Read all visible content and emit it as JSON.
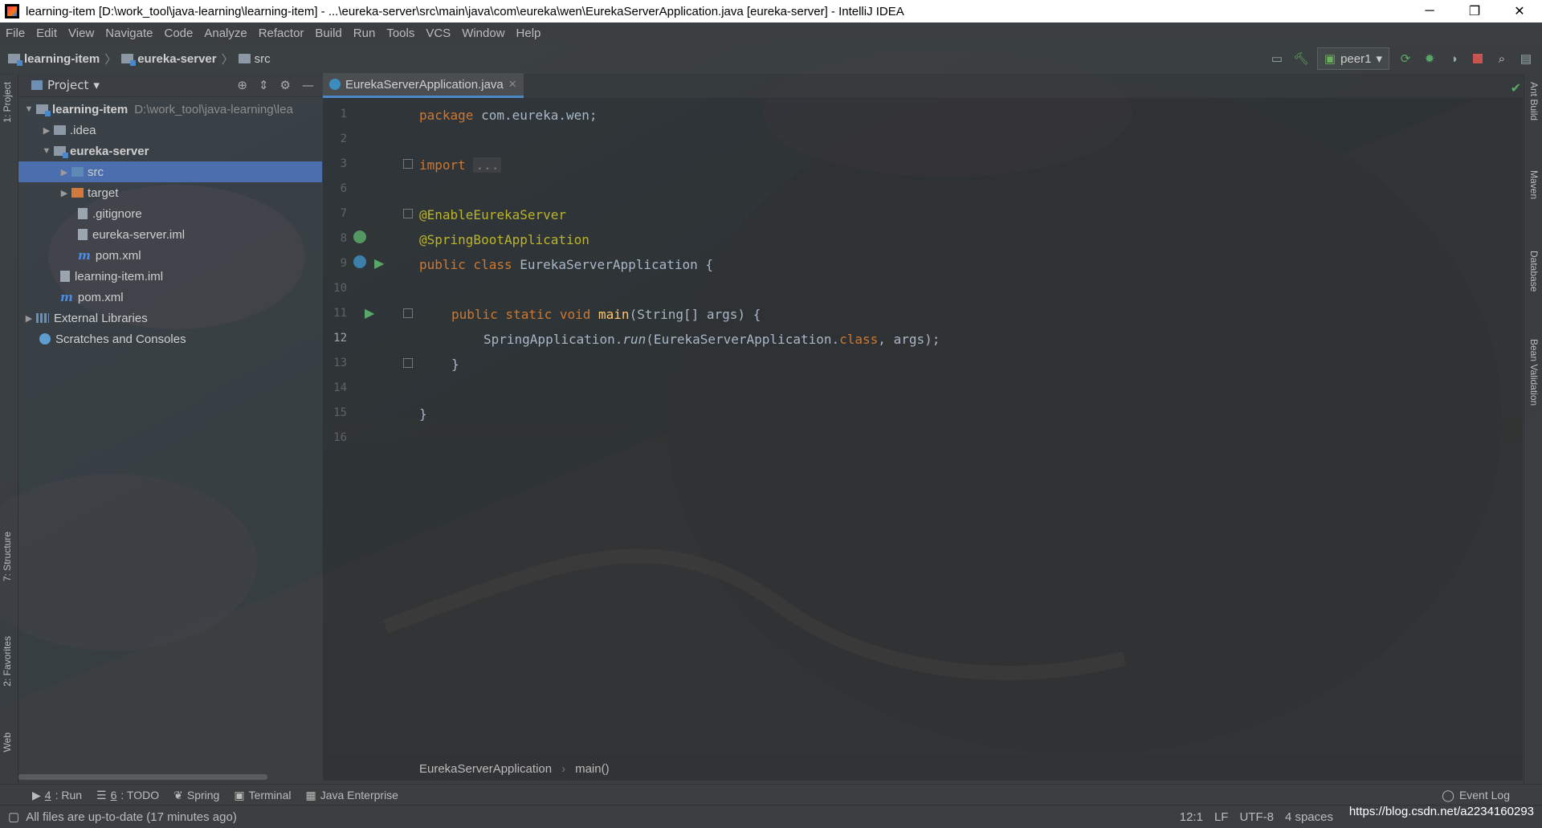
{
  "window": {
    "title": "learning-item [D:\\work_tool\\java-learning\\learning-item] - ...\\eureka-server\\src\\main\\java\\com\\eureka\\wen\\EurekaServerApplication.java [eureka-server] - IntelliJ IDEA",
    "controls": [
      "─",
      "❐",
      "✕"
    ]
  },
  "menu": [
    "File",
    "Edit",
    "View",
    "Navigate",
    "Code",
    "Analyze",
    "Refactor",
    "Build",
    "Run",
    "Tools",
    "VCS",
    "Window",
    "Help"
  ],
  "breadcrumb": [
    "learning-item",
    "eureka-server",
    "src"
  ],
  "toolbar": {
    "run_config": "peer1"
  },
  "left_strip": {
    "project": "1: Project",
    "structure": "7: Structure",
    "favorites": "2: Favorites",
    "web": "Web"
  },
  "right_strip": {
    "ant": "Ant Build",
    "maven": "Maven",
    "database": "Database",
    "bean": "Bean Validation"
  },
  "project_panel": {
    "title": "Project",
    "tree": [
      {
        "label": "learning-item",
        "path": "D:\\work_tool\\java-learning\\lea"
      },
      {
        "label": ".idea"
      },
      {
        "label": "eureka-server"
      },
      {
        "label": "src"
      },
      {
        "label": "target"
      },
      {
        "label": ".gitignore"
      },
      {
        "label": "eureka-server.iml"
      },
      {
        "label": "pom.xml"
      },
      {
        "label": "learning-item.iml"
      },
      {
        "label": "pom.xml"
      },
      {
        "label": "External Libraries"
      },
      {
        "label": "Scratches and Consoles"
      }
    ]
  },
  "editor": {
    "tab": "EurekaServerApplication.java",
    "line_numbers": [
      "1",
      "2",
      "3",
      "6",
      "7",
      "8",
      "9",
      "10",
      "11",
      "12",
      "13",
      "14",
      "15",
      "16"
    ],
    "code": {
      "l1_kw": "package",
      "l1_rest": " com.eureka.wen;",
      "l3_kw": "import",
      "l3_fold": "...",
      "l7": "@EnableEurekaServer",
      "l8": "@SpringBootApplication",
      "l9_kw": "public class",
      "l9_rest": " EurekaServerApplication {",
      "l11_kw": "public static void",
      "l11_fn": "main",
      "l11_rest": "(String[] args) {",
      "l12_a": "SpringApplication.",
      "l12_run": "run",
      "l12_b": "(EurekaServerApplication.",
      "l12_cls": "class",
      "l12_c": ", args);",
      "l13": "}",
      "l15": "}"
    },
    "crumbs": [
      "EurekaServerApplication",
      "main()"
    ]
  },
  "bottom_tools": [
    {
      "num": "4",
      "label": ": Run"
    },
    {
      "num": "6",
      "label": ": TODO"
    },
    {
      "label": "Spring"
    },
    {
      "label": "Terminal"
    },
    {
      "label": "Java Enterprise"
    }
  ],
  "event_log": "Event Log",
  "status": {
    "message": "All files are up-to-date (17 minutes ago)",
    "position": "12:1",
    "line_sep": "LF",
    "encoding": "UTF-8",
    "indent": "4 spaces"
  },
  "watermark": "https://blog.csdn.net/a2234160293",
  "colors": {
    "selection": "#4b6eaf",
    "keyword": "#cc7832",
    "annotation": "#bbb529",
    "method": "#ffc66d",
    "text": "#a9b7c6"
  }
}
